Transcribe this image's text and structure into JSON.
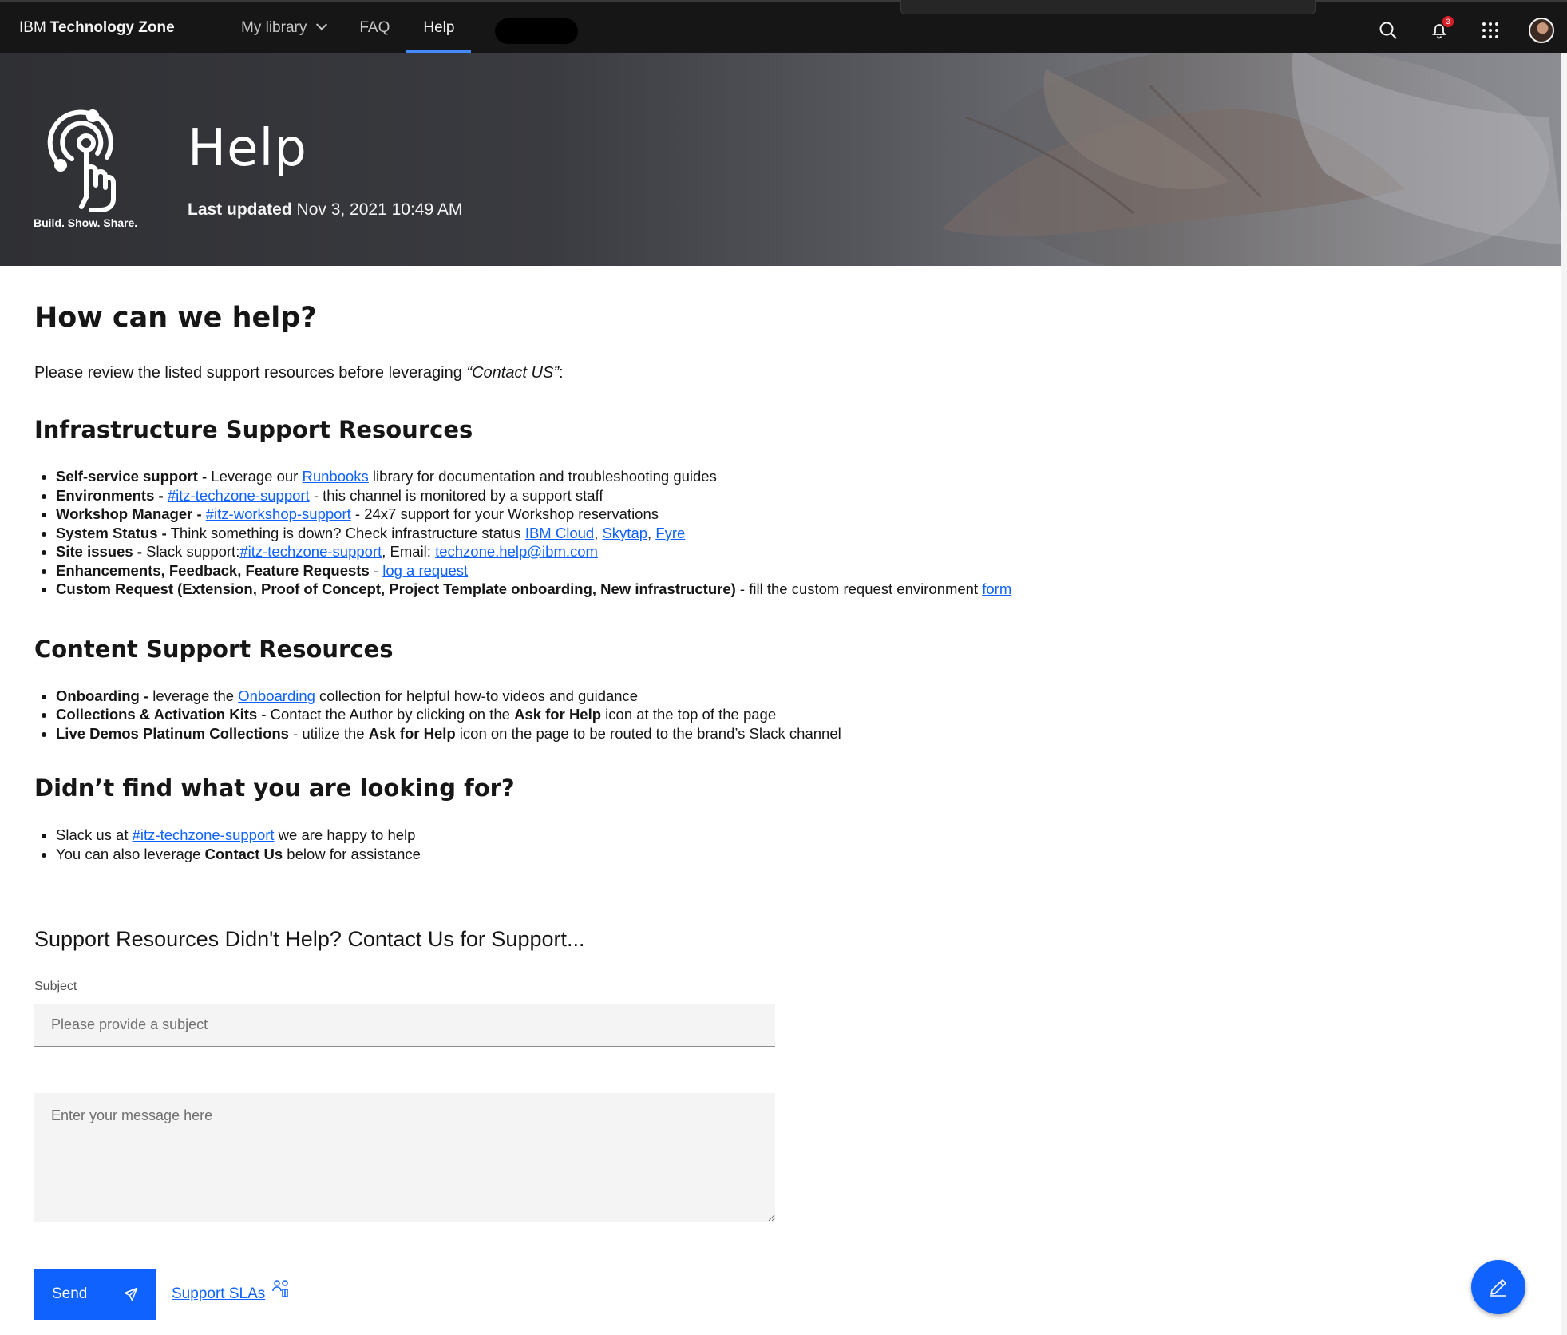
{
  "nav": {
    "brand_prefix": "IBM",
    "brand_name": "Technology Zone",
    "items": [
      {
        "label": "My library"
      },
      {
        "label": "FAQ"
      },
      {
        "label": "Help"
      }
    ],
    "notification_count": "3",
    "icons": [
      "search-icon",
      "notification-icon",
      "app-switcher-icon",
      "avatar"
    ]
  },
  "hero": {
    "logo_tagline": "Build. Show. Share.",
    "title": "Help",
    "updated_label": "Last updated",
    "updated_value": "Nov 3, 2021 10:49 AM"
  },
  "main": {
    "heading": "How can we help?",
    "intro_before": "Please review the listed support resources before leveraging ",
    "intro_quote": "“Contact US”",
    "intro_after": ":",
    "infra": {
      "heading": "Infrastructure Support Resources",
      "items": {
        "self_service": {
          "bold": "Self-service support -",
          "t1": " Leverage our ",
          "link": "Runbooks",
          "t2": " library for documentation and troubleshooting guides"
        },
        "environments": {
          "bold": "Environments -",
          "t1": " ",
          "link": "#itz-techzone-support",
          "t2": " - this channel is monitored by a support staff"
        },
        "workshop": {
          "bold": "Workshop Manager -",
          "t1": " ",
          "link": "#itz-workshop-support",
          "t2": " - 24x7 support for your Workshop reservations"
        },
        "system_status": {
          "bold": "System Status -",
          "t1": " Think something is down? Check infrastructure status ",
          "link1": "IBM Cloud",
          "sep1": ", ",
          "link2": "Skytap",
          "sep2": ", ",
          "link3": "Fyre"
        },
        "site_issues": {
          "bold": "Site issues -",
          "t1": " Slack support:",
          "link1": "#itz-techzone-support",
          "t2": ", Email: ",
          "link2": "techzone.help@ibm.com"
        },
        "enhancements": {
          "bold": "Enhancements, Feedback, Feature Requests",
          "t1": " - ",
          "link": "log a request"
        },
        "custom": {
          "bold": "Custom Request (Extension, Proof of Concept, Project Template onboarding, New infrastructure)",
          "t1": " - fill the custom request environment ",
          "link": "form"
        }
      }
    },
    "content": {
      "heading": "Content Support Resources",
      "items": {
        "onboarding": {
          "bold": "Onboarding -",
          "t1": " leverage the ",
          "link": "Onboarding",
          "t2": " collection for helpful how-to videos and guidance"
        },
        "collections": {
          "bold": "Collections & Activation Kits",
          "t1": " - Contact the Author by clicking on the ",
          "bold2": "Ask for Help",
          "t2": " icon at the top of the page"
        },
        "live_demos": {
          "bold": "Live Demos Platinum Collections",
          "t1": " - utilize the ",
          "bold2": "Ask for Help",
          "t2": " icon on the page to be routed to the brand’s Slack channel"
        }
      }
    },
    "not_found": {
      "heading": "Didn’t find what you are looking for?",
      "slack": {
        "t1": "Slack us at ",
        "link": "#itz-techzone-support",
        "t2": " we are happy to help"
      },
      "contact": {
        "t1": "You can also leverage ",
        "bold": "Contact Us",
        "t2": " below for assistance"
      }
    }
  },
  "form": {
    "heading": "Support Resources Didn't Help? Contact Us for Support...",
    "subject_label": "Subject",
    "subject_placeholder": "Please provide a subject",
    "subject_value": "",
    "message_placeholder": "Enter your message here",
    "message_value": "",
    "send_label": "Send",
    "sla_label": "Support SLAs"
  },
  "colors": {
    "nav_bg": "#161616",
    "accent": "#0f62fe",
    "active_tab": "#4589ff",
    "badge": "#da1e28"
  }
}
